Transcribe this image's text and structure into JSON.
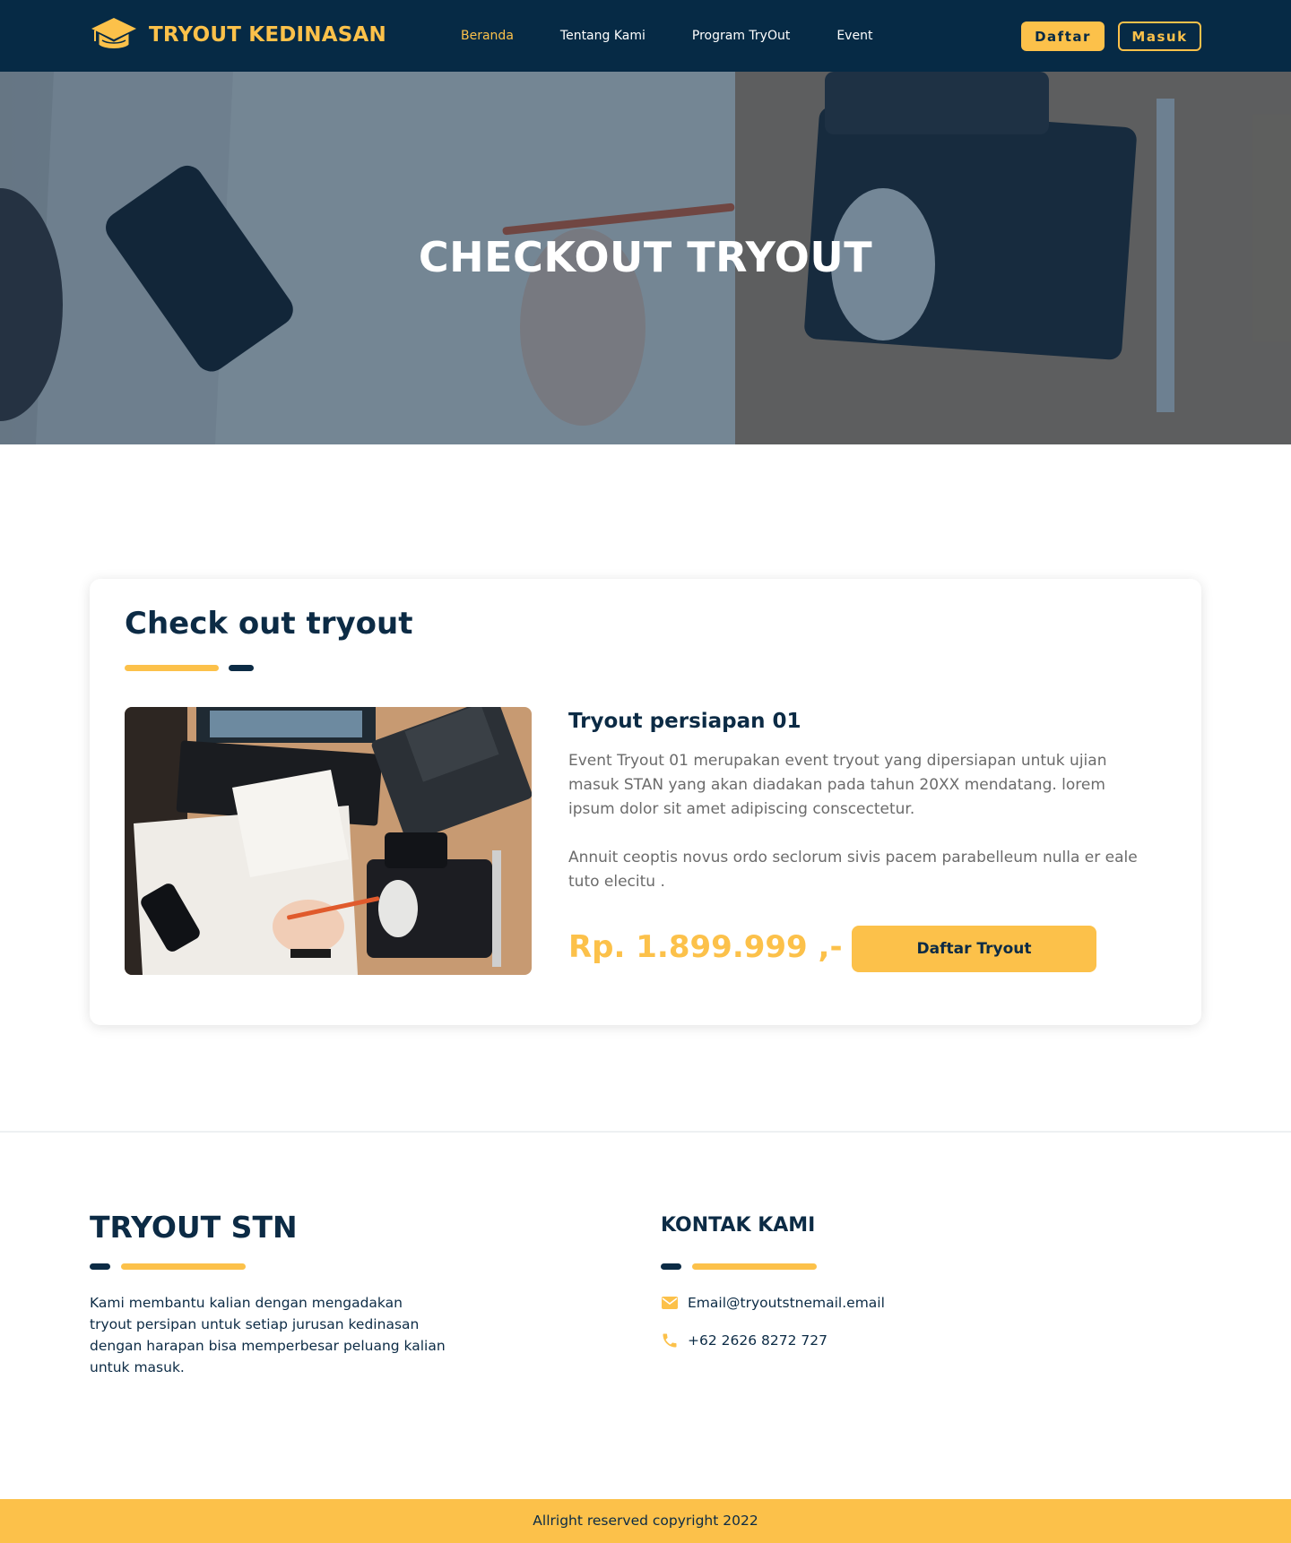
{
  "nav": {
    "brand": "TRYOUT KEDINASAN",
    "links": [
      "Beranda",
      "Tentang Kami",
      "Program TryOut",
      "Event"
    ],
    "daftar": "Daftar",
    "masuk": "Masuk"
  },
  "hero": {
    "title": "CHECKOUT TRYOUT"
  },
  "card": {
    "title": "Check out tryout",
    "product": {
      "name": "Tryout persiapan 01",
      "desc_1": "Event Tryout 01 merupakan event tryout yang dipersiapan untuk ujian masuk STAN yang akan  diadakan pada tahun 20XX mendatang. lorem ipsum dolor sit amet adipiscing conscectetur.",
      "desc_2": "Annuit ceoptis novus ordo seclorum sivis pacem parabelleum nulla er eale tuto elecitu .",
      "price": "Rp. 1.899.999 ,-",
      "button": "Daftar Tryout"
    }
  },
  "footer": {
    "title": "TRYOUT STN",
    "description": "Kami membantu kalian dengan mengadakan tryout persipan untuk setiap jurusan kedinasan dengan harapan bisa memperbesar peluang kalian untuk masuk.",
    "contact_title": "KONTAK KAMI",
    "email": "Email@tryoutstnemail.email",
    "phone": "+62 2626 8272 727",
    "copyright": "Allright reserved copyright 2022"
  },
  "colors": {
    "navy": "#062a45",
    "accent": "#fcc14a",
    "text_muted": "#6b6b6b"
  },
  "icons": {
    "brand": "graduation-cap-icon",
    "email": "mail-icon",
    "phone": "phone-icon"
  }
}
